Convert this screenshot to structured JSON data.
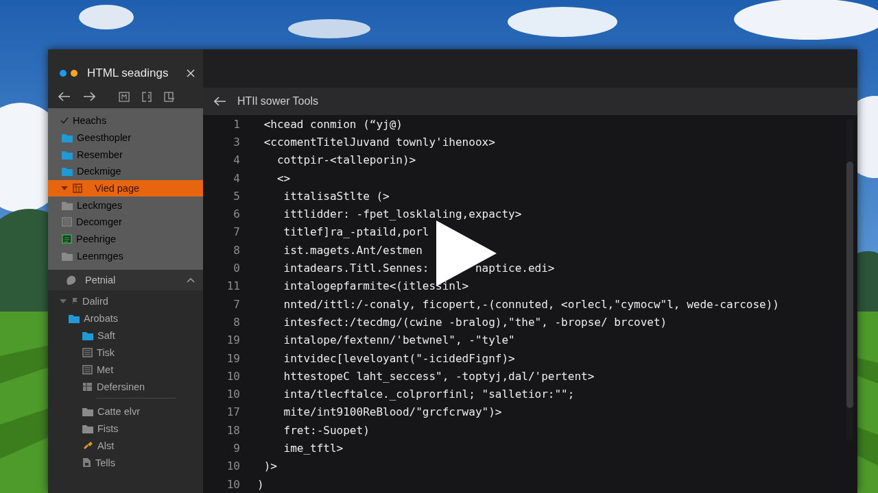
{
  "sidebar": {
    "title": "HTML seadings",
    "dots": [
      {
        "color": "#1e9bf0"
      },
      {
        "color": "#f5a623"
      }
    ],
    "sections": [
      {
        "items": [
          {
            "label": "Heachs",
            "kind": "group",
            "checked": true,
            "selected": false,
            "children": [
              {
                "label": "Geesthopler",
                "kind": "folder",
                "color": "#1e9bd7",
                "selected": false
              },
              {
                "label": "Resember",
                "kind": "folder",
                "color": "#1e9bd7",
                "selected": false
              },
              {
                "label": "Deckmige",
                "kind": "folder",
                "color": "#1e9bd7",
                "selected": false
              }
            ]
          },
          {
            "label": "Vied page",
            "kind": "grid",
            "expanded": true,
            "selected": true,
            "children": [
              {
                "label": "Leckmges",
                "kind": "folder",
                "color": "#8a8a8a",
                "selected": false
              },
              {
                "label": "Decomger",
                "kind": "list",
                "selected": false
              },
              {
                "label": "Peehrige",
                "kind": "sheet",
                "selected": false
              },
              {
                "label": "Leenmges",
                "kind": "folder",
                "color": "#8a8a8a",
                "selected": false
              }
            ]
          }
        ]
      },
      {
        "header": "Petnial",
        "expanded": true,
        "items": [
          {
            "label": "Dalird",
            "kind": "flag",
            "expanded": true,
            "selected": false,
            "children": [
              {
                "label": "Arobats",
                "kind": "folder",
                "color": "#1e9bd7",
                "selected": false,
                "children": [
                  {
                    "label": "Saft",
                    "kind": "folder",
                    "color": "#1e9bd7",
                    "selected": false
                  },
                  {
                    "label": "Tisk",
                    "kind": "list",
                    "selected": false
                  },
                  {
                    "label": "Met",
                    "kind": "list",
                    "selected": false
                  },
                  {
                    "label": "Defersinen",
                    "kind": "cabinet",
                    "selected": false
                  },
                  {
                    "label": "Catte elvr",
                    "kind": "folder",
                    "color": "#8a8a8a",
                    "separator": true,
                    "selected": false
                  },
                  {
                    "label": "Fists",
                    "kind": "folder",
                    "color": "#8a8a8a",
                    "selected": false
                  },
                  {
                    "label": "Alst",
                    "kind": "link",
                    "selected": false
                  },
                  {
                    "label": "Tells",
                    "kind": "doc",
                    "selected": false
                  }
                ]
              }
            ]
          }
        ]
      }
    ]
  },
  "editor": {
    "title": "HTIl sower Tools",
    "lines": [
      {
        "number": "1",
        "text": " <hcead conmion (“yj@)"
      },
      {
        "number": "3",
        "text": " <ccomentTitelJuvand townly'ihenoox>"
      },
      {
        "number": "4",
        "text": "   cottpir-<talleporin)>"
      },
      {
        "number": "4",
        "text": "   <>"
      },
      {
        "number": "5",
        "text": "    ittalisaStlte (>"
      },
      {
        "number": "6",
        "text": "    ittlidder: -fpet_losklaling,expacty>"
      },
      {
        "number": "7",
        "text": "    titlef]ra_-ptaild,porl"
      },
      {
        "number": "8",
        "text": "    ist.magets.Ant/estmen"
      },
      {
        "number": "0",
        "text": "    intadears.Titl.Sennes:",
        "tail": "naptice.edi>"
      },
      {
        "number": "11",
        "text": "    intalogepfarmite<(itlessinl>"
      },
      {
        "number": "7",
        "text": "    nnted/ittl:/-conaly, ficopert,-(connuted, <orlecl,\"cymocw\"l, wede-carcose))"
      },
      {
        "number": "8",
        "text": "    intesfect:/tecdmg/(cwine -bralog),\"the\", -bropse/ brcovet)"
      },
      {
        "number": "19",
        "text": "    intalope/fextenn/'betwnel\", -\"tyle\""
      },
      {
        "number": "19",
        "text": "    intvidec[leveloyant(\"-icidedFignf)>"
      },
      {
        "number": "10",
        "text": "    httestopeC laht_seccess\", -toptyj,dal/'pertent>"
      },
      {
        "number": "10",
        "text": "    inta/tlecftalce._colprorfinl; \"salletior:\"\";"
      },
      {
        "number": "17",
        "text": "    mite/int9100ReBlood/\"grcfcrway\")>"
      },
      {
        "number": "18",
        "text": "    fret:-Suopet)"
      },
      {
        "number": "9",
        "text": "    ime_tftl>"
      },
      {
        "number": "10",
        "text": " )>"
      },
      {
        "number": "10",
        "text": ")"
      }
    ]
  },
  "overlay": {
    "kind": "play"
  }
}
